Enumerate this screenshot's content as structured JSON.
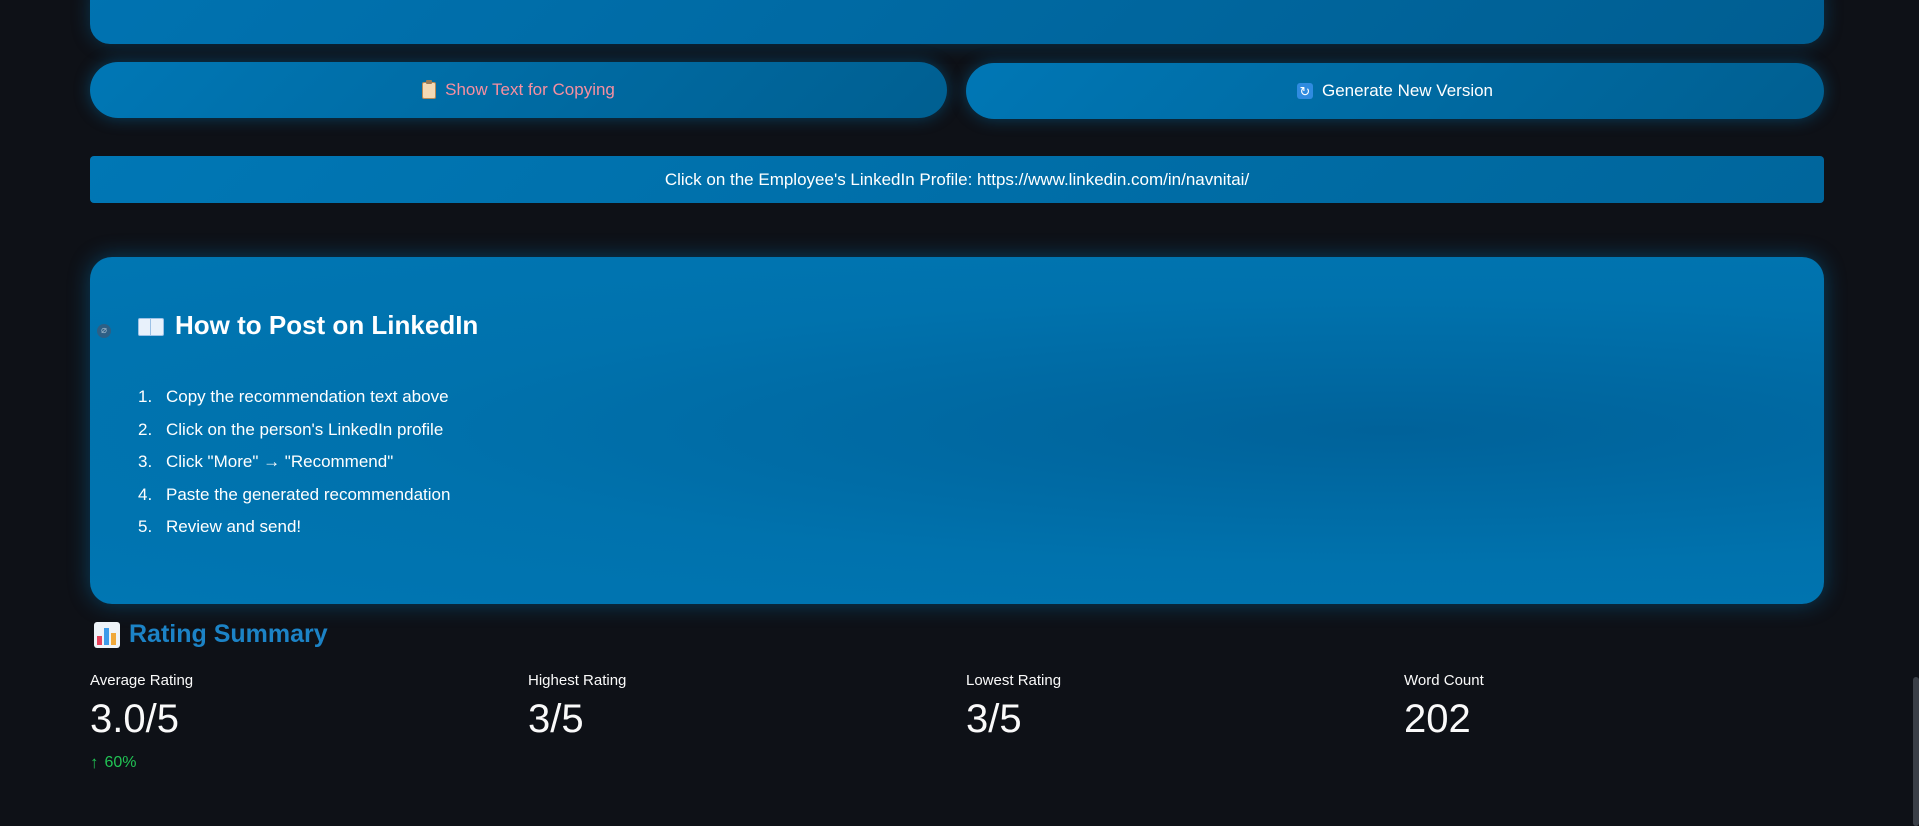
{
  "buttons": {
    "copy_label": "Show Text for Copying",
    "copy_icon": "clipboard-icon",
    "generate_label": "Generate New Version",
    "generate_icon": "refresh-icon"
  },
  "profile_link": {
    "text": "Click on the Employee's LinkedIn Profile: https://www.linkedin.com/in/navnitai/"
  },
  "howto": {
    "icon": "open-book-icon",
    "title": "How to Post on LinkedIn",
    "steps": [
      {
        "num": "1.",
        "text": "Copy the recommendation text above"
      },
      {
        "num": "2.",
        "text": "Click on the person's LinkedIn profile"
      },
      {
        "num": "3.",
        "text": "Click \"More\" → \"Recommend\""
      },
      {
        "num": "4.",
        "text": "Paste the generated recommendation"
      },
      {
        "num": "5.",
        "text": "Review and send!"
      }
    ]
  },
  "summary": {
    "icon": "bar-chart-icon",
    "title": "Rating Summary",
    "metrics": [
      {
        "label": "Average Rating",
        "value": "3.0/5",
        "delta": "60%"
      },
      {
        "label": "Highest Rating",
        "value": "3/5"
      },
      {
        "label": "Lowest Rating",
        "value": "3/5"
      },
      {
        "label": "Word Count",
        "value": "202"
      }
    ]
  },
  "colors": {
    "background": "#0e1117",
    "linkedin_blue": "#0077b5",
    "summary_title": "#1c83c6",
    "copy_text": "#f78fa0",
    "delta_positive": "#21c354"
  }
}
